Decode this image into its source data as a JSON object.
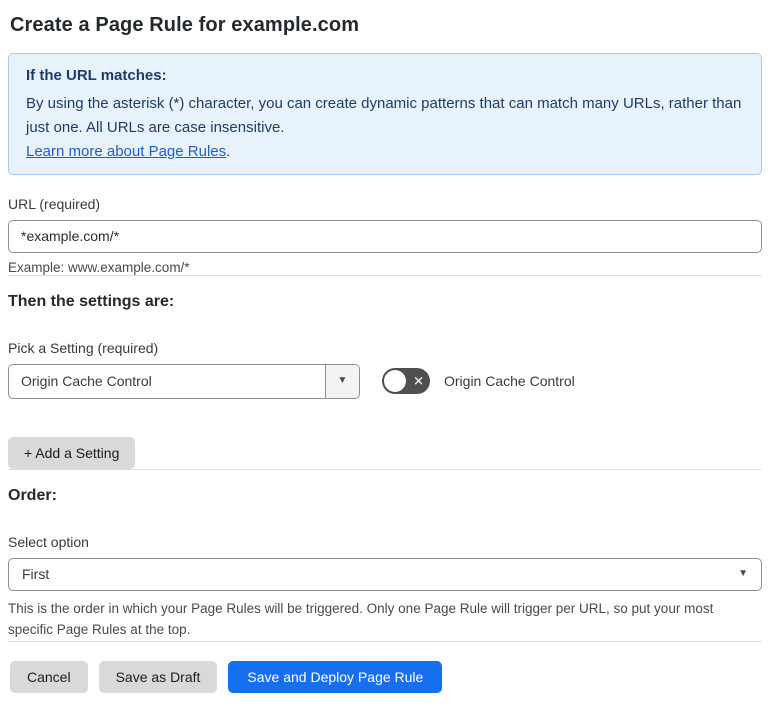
{
  "page": {
    "title": "Create a Page Rule for example.com"
  },
  "info_box": {
    "heading": "If the URL matches:",
    "body": "By using the asterisk (*) character, you can create dynamic patterns that can match many URLs, rather than just one. All URLs are case insensitive.",
    "link_label": "Learn more about Page Rules",
    "link_suffix": "."
  },
  "url_section": {
    "label": "URL (required)",
    "input_value": "*example.com/*",
    "example": "Example: www.example.com/*"
  },
  "settings_section": {
    "heading": "Then the settings are:",
    "picker_label": "Pick a Setting (required)",
    "selected_setting": "Origin Cache Control",
    "toggle_state": "off",
    "toggle_label": "Origin Cache Control",
    "add_button_label": "+ Add a Setting"
  },
  "order_section": {
    "heading": "Order:",
    "select_label": "Select option",
    "selected_option": "First",
    "help_text": "This is the order in which your Page Rules will be triggered. Only one Page Rule will trigger per URL, so put your most specific Page Rules at the top."
  },
  "footer": {
    "cancel_label": "Cancel",
    "save_draft_label": "Save as Draft",
    "save_deploy_label": "Save and Deploy Page Rule"
  },
  "icons": {
    "dropdown_arrow": "▼",
    "toggle_x": "✕"
  },
  "colors": {
    "accent_blue": "#1570f0",
    "info_bg": "#e8f2fc",
    "info_border": "#a7cdeb",
    "info_text": "#1d3c6d",
    "link_blue": "#1f5fc9",
    "toggle_off_bg": "#4f4f4f",
    "button_gray": "#d9d9d9"
  }
}
